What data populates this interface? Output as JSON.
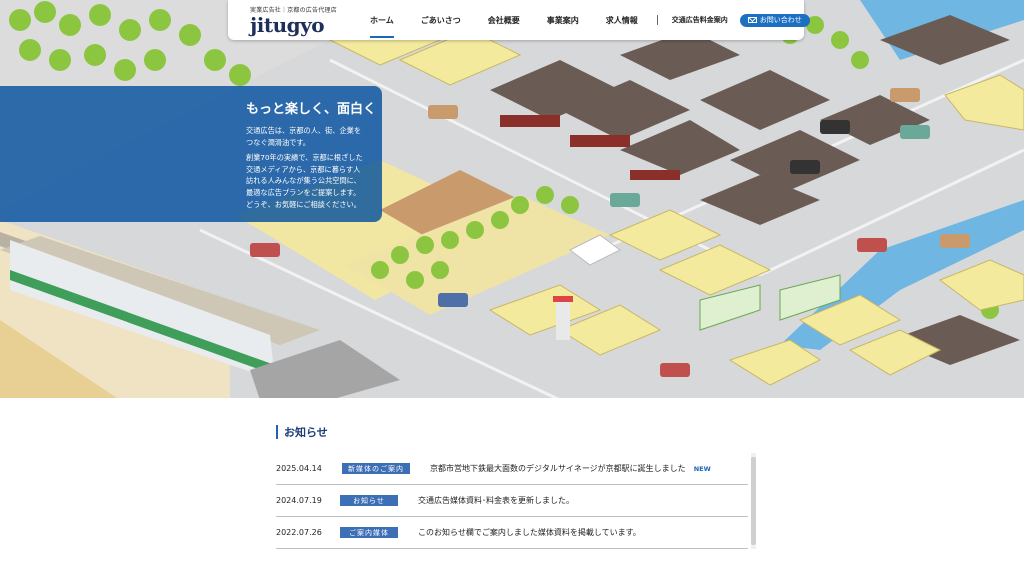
{
  "header": {
    "tagline": "実業広告社｜京都の広告代理店",
    "logo_text": "jitugyo",
    "nav": [
      {
        "label": "ホーム",
        "active": true
      },
      {
        "label": "ごあいさつ",
        "active": false
      },
      {
        "label": "会社概要",
        "active": false
      },
      {
        "label": "事業案内",
        "active": false
      },
      {
        "label": "求人情報",
        "active": false
      }
    ],
    "fee_link": "交通広告料金案内",
    "contact_label": "お問い合わせ",
    "contact_icon": "mail-icon",
    "accent_color": "#1d6fc1"
  },
  "hero": {
    "title": "もっと楽しく、面白く",
    "lines_a": [
      "交通広告は、京都の人、街、企業を",
      "つなぐ潤滑油です。"
    ],
    "lines_b": [
      "創業70年の実績で、京都に根ざした",
      "交通メディアから、京都に暮らす人",
      "訪れる人みんなが集う公共空間に、",
      "最適な広告プランをご提案します。",
      "どうぞ、お気軽にご相談ください。"
    ],
    "panel_color": "#004e9e"
  },
  "news": {
    "heading": "お知らせ",
    "items": [
      {
        "date": "2025.04.14",
        "badge": "新媒体のご案内",
        "text": "京都市営地下鉄最大面数のデジタルサイネージが京都駅に誕生しました",
        "new_label": "NEW"
      },
      {
        "date": "2024.07.19",
        "badge": "お知らせ",
        "text": "交通広告媒体資料･料金表を更新しました。",
        "new_label": ""
      },
      {
        "date": "2022.07.26",
        "badge": "ご案内媒体",
        "text": "このお知らせ欄でご案内しました媒体資料を掲載しています。",
        "new_label": ""
      }
    ],
    "badge_color": "#3d6fb6"
  }
}
